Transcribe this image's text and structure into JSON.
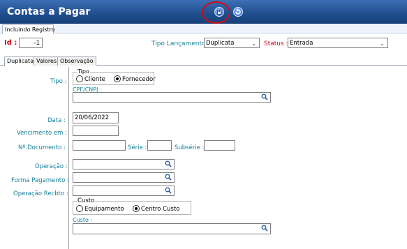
{
  "window": {
    "title": "Contas a Pagar",
    "save_icon": "save-icon",
    "refresh_icon": "refresh-icon"
  },
  "mode_tab": "Incluindo Registro",
  "header": {
    "id_label": "Id :",
    "id_value": "-1",
    "tipo_lancamento_label": "Tipo Lançamento :",
    "tipo_lancamento_value": "Duplicata",
    "status_label": "Status :",
    "status_value": "Entrada"
  },
  "tabs": [
    {
      "label": "Duplicata",
      "active": true
    },
    {
      "label": "Valores",
      "active": false
    },
    {
      "label": "Observação",
      "active": false
    }
  ],
  "form": {
    "tipo_label": "Tipo :",
    "tipo_group_title": "Tipo",
    "tipo_options": [
      "Cliente",
      "Fornecedor"
    ],
    "tipo_selected": "Fornecedor",
    "cpf_label": "CPF/CNPJ :",
    "cpf_value": "",
    "data_label": "Data :",
    "data_value": "20/06/2022",
    "vencimento_label": "Vencimento em :",
    "vencimento_value": "",
    "documento_label": "Nº.Documento :",
    "documento_value": "",
    "serie_label": "Série :",
    "serie_value": "",
    "subserie_label": "Subsérie :",
    "subserie_value": "",
    "operacao_label": "Operação :",
    "operacao_value": "",
    "forma_pagamento_label": "Forma Pagamento :",
    "forma_pagamento_value": "",
    "operacao_recbto_label": "Operação Recbto :",
    "operacao_recbto_value": "",
    "custo_group_title": "Custo",
    "custo_options": [
      "Equipamento",
      "Centro Custo"
    ],
    "custo_selected": "Centro Custo",
    "custo_label": "Custo :",
    "custo_value": ""
  },
  "colors": {
    "titlebar": "#21508f",
    "required_label": "#d0001c",
    "field_label": "#13809a",
    "highlight_ring": "#d40a14"
  }
}
